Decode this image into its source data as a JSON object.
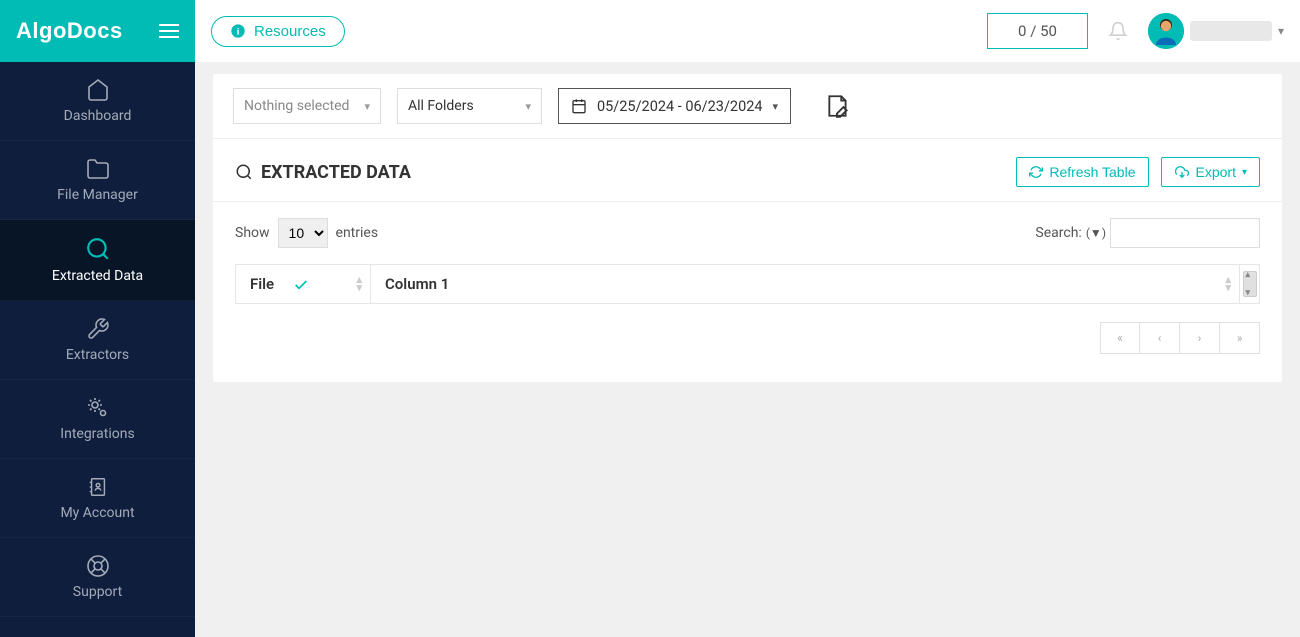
{
  "brand": "AlgoDocs",
  "header": {
    "resources_label": "Resources",
    "counter": "0 / 50"
  },
  "sidebar": {
    "items": [
      {
        "label": "Dashboard"
      },
      {
        "label": "File Manager"
      },
      {
        "label": "Extracted Data"
      },
      {
        "label": "Extractors"
      },
      {
        "label": "Integrations"
      },
      {
        "label": "My Account"
      },
      {
        "label": "Support"
      }
    ]
  },
  "filters": {
    "type_selected": "Nothing selected",
    "folder_selected": "All Folders",
    "date_range": "05/25/2024 - 06/23/2024"
  },
  "section": {
    "title": "EXTRACTED DATA",
    "refresh_label": "Refresh Table",
    "export_label": "Export"
  },
  "table_controls": {
    "show_label": "Show",
    "entries_value": "10",
    "entries_label": "entries",
    "search_label": "Search:"
  },
  "table": {
    "columns": {
      "file": "File",
      "col1": "Column 1"
    }
  }
}
